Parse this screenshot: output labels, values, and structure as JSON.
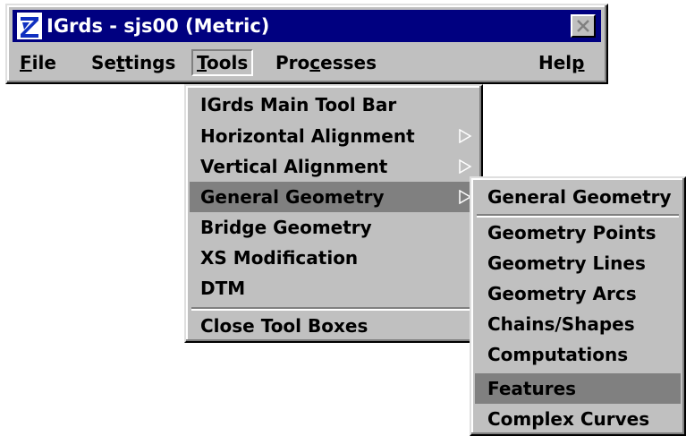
{
  "window": {
    "title": "IGrds - sjs00 (Metric)",
    "icon": "igrds-logo-icon",
    "close_icon": "close-icon"
  },
  "menubar": {
    "items": [
      {
        "label_u": "F",
        "label_rest": "ile"
      },
      {
        "label_pre": "Se",
        "label_u": "t",
        "label_rest": "tings"
      },
      {
        "label_u": "T",
        "label_rest": "ools"
      },
      {
        "label_pre": "Pro",
        "label_u": "c",
        "label_rest": "esses"
      },
      {
        "label_pre": "Hel",
        "label_u": "p",
        "label_rest": ""
      }
    ],
    "open_menu": "Tools"
  },
  "tools_menu": {
    "items": [
      {
        "label": "IGrds Main Tool Bar"
      },
      {
        "label": "Horizontal Alignment",
        "submenu": true
      },
      {
        "label": "Vertical Alignment",
        "submenu": true
      },
      {
        "label": "General Geometry",
        "submenu": true,
        "selected": true
      },
      {
        "label": "Bridge Geometry"
      },
      {
        "label": "XS Modification"
      },
      {
        "label": "DTM"
      },
      {
        "label": "Close Tool Boxes"
      }
    ]
  },
  "geometry_menu": {
    "items": [
      {
        "label": "General Geometry"
      },
      {
        "label": "Geometry Points"
      },
      {
        "label": "Geometry Lines"
      },
      {
        "label": "Geometry Arcs"
      },
      {
        "label": "Chains/Shapes"
      },
      {
        "label": "Computations"
      },
      {
        "label": "Features",
        "selected": true
      },
      {
        "label": "Complex Curves"
      }
    ]
  },
  "colors": {
    "titlebar": "#000080",
    "face": "#c0c0c0",
    "highlight": "#808080"
  }
}
